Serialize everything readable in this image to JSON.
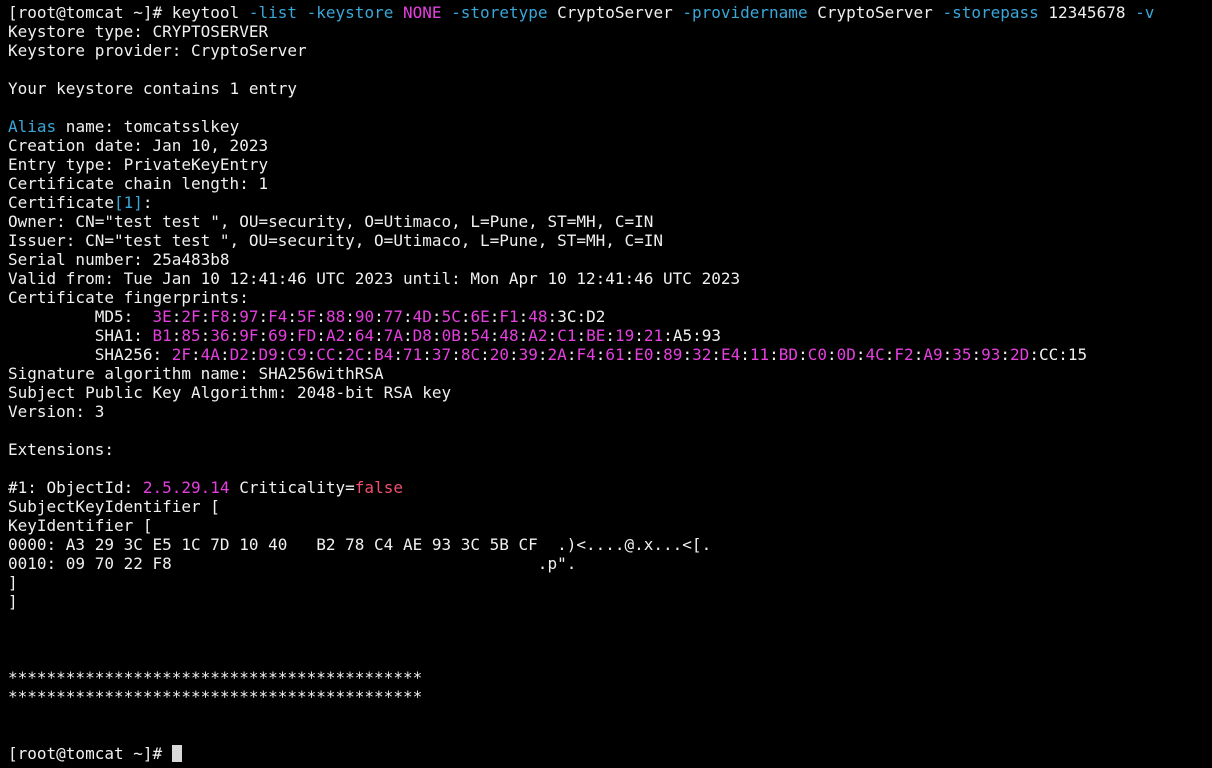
{
  "terminal": {
    "cmd": {
      "prompt": "[root@tomcat ~]# ",
      "prog": "keytool ",
      "flag_list": "-list",
      "sp1": " ",
      "flag_keystore": "-keystore",
      "sp2": " ",
      "keystore_val": "NONE",
      "sp3": " ",
      "flag_storetype": "-storetype",
      "storetype_val": " CryptoServer ",
      "flag_providername": "-providername",
      "providername_val": " CryptoServer ",
      "flag_storepass": "-storepass",
      "storepass_val": " 12345678 ",
      "flag_v": "-v"
    },
    "keystore_type": "Keystore type: CRYPTOSERVER",
    "keystore_provider": "Keystore provider: CryptoServer",
    "contains": "Your keystore contains 1 entry",
    "alias_label": "Alias",
    "alias_rest": " name: tomcatsslkey",
    "creation_date": "Creation date: Jan 10, 2023",
    "entry_type": "Entry type: PrivateKeyEntry",
    "chain_length": "Certificate chain length: 1",
    "cert_label": "Certificate",
    "cert_index": "[1]",
    "cert_colon": ":",
    "owner": "Owner: CN=\"test test \", OU=security, O=Utimaco, L=Pune, ST=MH, C=IN",
    "issuer": "Issuer: CN=\"test test \", OU=security, O=Utimaco, L=Pune, ST=MH, C=IN",
    "serial": "Serial number: 25a483b8",
    "valid": "Valid from: Tue Jan 10 12:41:46 UTC 2023 until: Mon Apr 10 12:41:46 UTC 2023",
    "fp_header": "Certificate fingerprints:",
    "md5": {
      "label": "         MD5:  ",
      "parts": [
        "3E",
        ":",
        "2F",
        ":",
        "F8",
        ":",
        "97",
        ":",
        "F4",
        ":",
        "5F",
        ":",
        "88",
        ":",
        "90",
        ":",
        "77",
        ":",
        "4D",
        ":",
        "5C",
        ":",
        "6E",
        ":",
        "F1",
        ":",
        "48",
        ":",
        "3C",
        ":",
        "D2"
      ]
    },
    "sha1": {
      "label": "         SHA1: ",
      "parts": [
        "B1",
        ":",
        "85",
        ":",
        "36",
        ":",
        "9F",
        ":",
        "69",
        ":",
        "FD",
        ":",
        "A2",
        ":",
        "64",
        ":",
        "7A",
        ":",
        "D8",
        ":",
        "0B",
        ":",
        "54",
        ":",
        "48",
        ":",
        "A2",
        ":",
        "C1",
        ":",
        "BE",
        ":",
        "19",
        ":",
        "21",
        ":",
        "A5",
        ":",
        "93"
      ]
    },
    "sha256": {
      "label": "         SHA256: ",
      "parts": [
        "2F",
        ":",
        "4A",
        ":",
        "D2",
        ":",
        "D9",
        ":",
        "C9",
        ":",
        "CC",
        ":",
        "2C",
        ":",
        "B4",
        ":",
        "71",
        ":",
        "37",
        ":",
        "8C",
        ":",
        "20",
        ":",
        "39",
        ":",
        "2A",
        ":",
        "F4",
        ":",
        "61",
        ":",
        "E0",
        ":",
        "89",
        ":",
        "32",
        ":",
        "E4",
        ":",
        "11",
        ":",
        "BD",
        ":",
        "C0",
        ":",
        "0D",
        ":",
        "4C",
        ":",
        "F2",
        ":",
        "A9",
        ":",
        "35",
        ":",
        "93",
        ":",
        "2D",
        ":",
        "CC",
        ":",
        "15"
      ]
    },
    "sig_alg": "Signature algorithm name: SHA256withRSA",
    "pubkey_alg": "Subject Public Key Algorithm: 2048-bit RSA key",
    "version": "Version: 3",
    "extensions": "Extensions:",
    "ext1_prefix": "#1: ObjectId: ",
    "ext1_oid": "2.5.29.14",
    "ext1_crit_label": " Criticality=",
    "ext1_crit_val": "false",
    "ski_open": "SubjectKeyIdentifier [",
    "ki_open": "KeyIdentifier [",
    "hex1": "0000: A3 29 3C E5 1C 7D 10 40   B2 78 C4 AE 93 3C 5B CF  .)<....@.x...<[.",
    "hex2": "0010: 09 70 22 F8                                      .p\".",
    "close1": "]",
    "close2": "]",
    "stars1": "*******************************************",
    "stars2": "*******************************************",
    "final_prompt": "[root@tomcat ~]# "
  },
  "colors": {
    "background": "#000000",
    "foreground": "#f0f0f0",
    "cyan": "#3aa7d9",
    "magenta": "#e63fe0",
    "red": "#f0506e"
  }
}
